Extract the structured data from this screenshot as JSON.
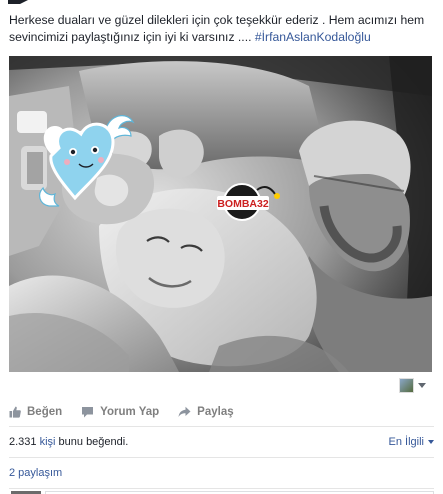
{
  "post": {
    "text": "Herkese duaları ve güzel dilekleri için çok teşekkür ederiz . Hem acımızı hem sevincimizi paylaştığınız için iyi ki varsınız .... ",
    "hashtag": "#İrfanAslanKodaloğlu",
    "hashtag_color": "#365899"
  },
  "photo": {
    "sticker_brand": "BOMBA32",
    "sticker_brand_color": "#cc2020"
  },
  "actions": {
    "like_label": "Beğen",
    "comment_label": "Yorum Yap",
    "share_label": "Paylaş"
  },
  "engagement": {
    "likes_number": "2.331 ",
    "likes_link": "kişi",
    "likes_suffix": " bunu beğendi.",
    "sort_label": "En İlgili",
    "shares_label": "2 paylaşım"
  },
  "icons": {
    "like": "thumbs-up-icon",
    "comment": "speech-bubble-icon",
    "share": "share-arrow-icon",
    "media": "camera-avatar-icon"
  }
}
